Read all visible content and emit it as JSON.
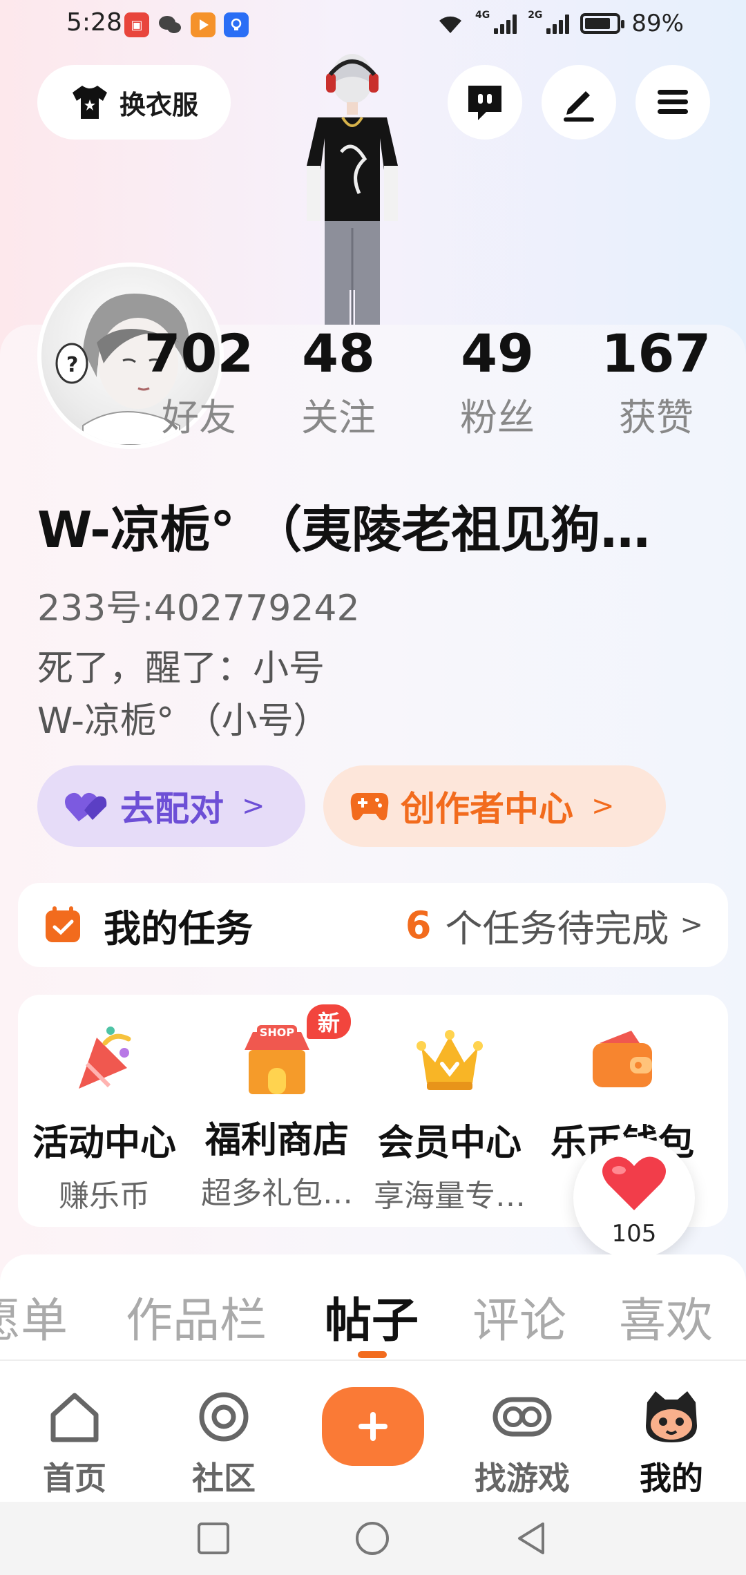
{
  "status_bar": {
    "time": "5:28",
    "network_labels": [
      "4G",
      "2G"
    ],
    "battery_percent": "89%",
    "battery_level": 0.89
  },
  "header": {
    "dress_label": "换衣服"
  },
  "profile": {
    "stats": [
      {
        "value": "702",
        "label": "好友"
      },
      {
        "value": "48",
        "label": "关注"
      },
      {
        "value": "49",
        "label": "粉丝"
      },
      {
        "value": "167",
        "label": "获赞"
      }
    ],
    "nickname": "W-凉栀° （夷陵老祖见狗…",
    "uid": "233号:402779242",
    "bio_lines": [
      "死了，醒了：小号",
      "W-凉栀° （小号）"
    ]
  },
  "actions": {
    "match_label": "去配对",
    "creator_label": "创作者中心"
  },
  "tasks": {
    "title": "我的任务",
    "count": "6",
    "suffix": "个任务待完成"
  },
  "services": [
    {
      "title": "活动中心",
      "subtitle": "赚乐币"
    },
    {
      "title": "福利商店",
      "subtitle": "超多礼包…",
      "badge": "新",
      "shop_sign": "SHOP"
    },
    {
      "title": "会员中心",
      "subtitle": "享海量专…"
    },
    {
      "title": "乐币钱包",
      "subtitle": ""
    }
  ],
  "likes": {
    "count": "105"
  },
  "tabs": [
    "愿单",
    "作品栏",
    "帖子",
    "评论",
    "喜欢"
  ],
  "active_tab": "帖子",
  "bottom_nav": [
    {
      "label": "首页"
    },
    {
      "label": "社区"
    },
    {
      "label": "找游戏"
    },
    {
      "label": "我的"
    }
  ],
  "colors": {
    "accent": "#f26b1d",
    "plus_button": "#fa7a36",
    "match_purple": "#6d4fd6",
    "badge_red": "#f2453d"
  }
}
